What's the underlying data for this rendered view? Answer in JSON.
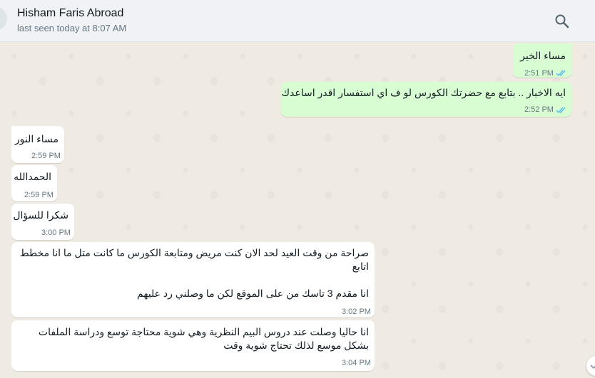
{
  "header": {
    "contact_name": "Hisham Faris Abroad",
    "status": "last seen today at 8:07 AM"
  },
  "icons": {
    "search": "search-icon",
    "read_receipt": "double-check-icon",
    "scroll_down": "chevron-down-icon"
  },
  "colors": {
    "outgoing_bubble": "#d9fdd3",
    "incoming_bubble": "#ffffff",
    "read_tick": "#53bdeb",
    "chat_background": "#efeae2"
  },
  "messages": [
    {
      "direction": "out",
      "text": "مساء الخير",
      "time": "2:51 PM",
      "read": true
    },
    {
      "direction": "out",
      "text": "ايه الاخبار .. بتابع مع حضرتك الكورس لو ف اي استفسار اقدر اساعدك",
      "time": "2:52 PM",
      "read": true
    },
    {
      "direction": "in",
      "text": "مساء النور",
      "time": "2:59 PM"
    },
    {
      "direction": "in",
      "text": "الحمدالله",
      "time": "2:59 PM"
    },
    {
      "direction": "in",
      "text": "شكرا للسؤال",
      "time": "3:00 PM"
    },
    {
      "direction": "in",
      "text": "صراحة من وقت العيد لحد الان كنت مريض ومتابعة الكورس ما كانت متل ما انا مخطط\nاتابع\n\nانا مقدم 3 تاسك من على الموقع لكن ما وصلني رد عليهم",
      "time": "3:02 PM"
    },
    {
      "direction": "in",
      "text": "انا حاليا وصلت عند دروس البيم النظرية وهي شوية محتاجة توسع ودراسة الملفات\nبشكل موسع لذلك تحتاج شوية وقت",
      "time": "3:04 PM"
    }
  ]
}
